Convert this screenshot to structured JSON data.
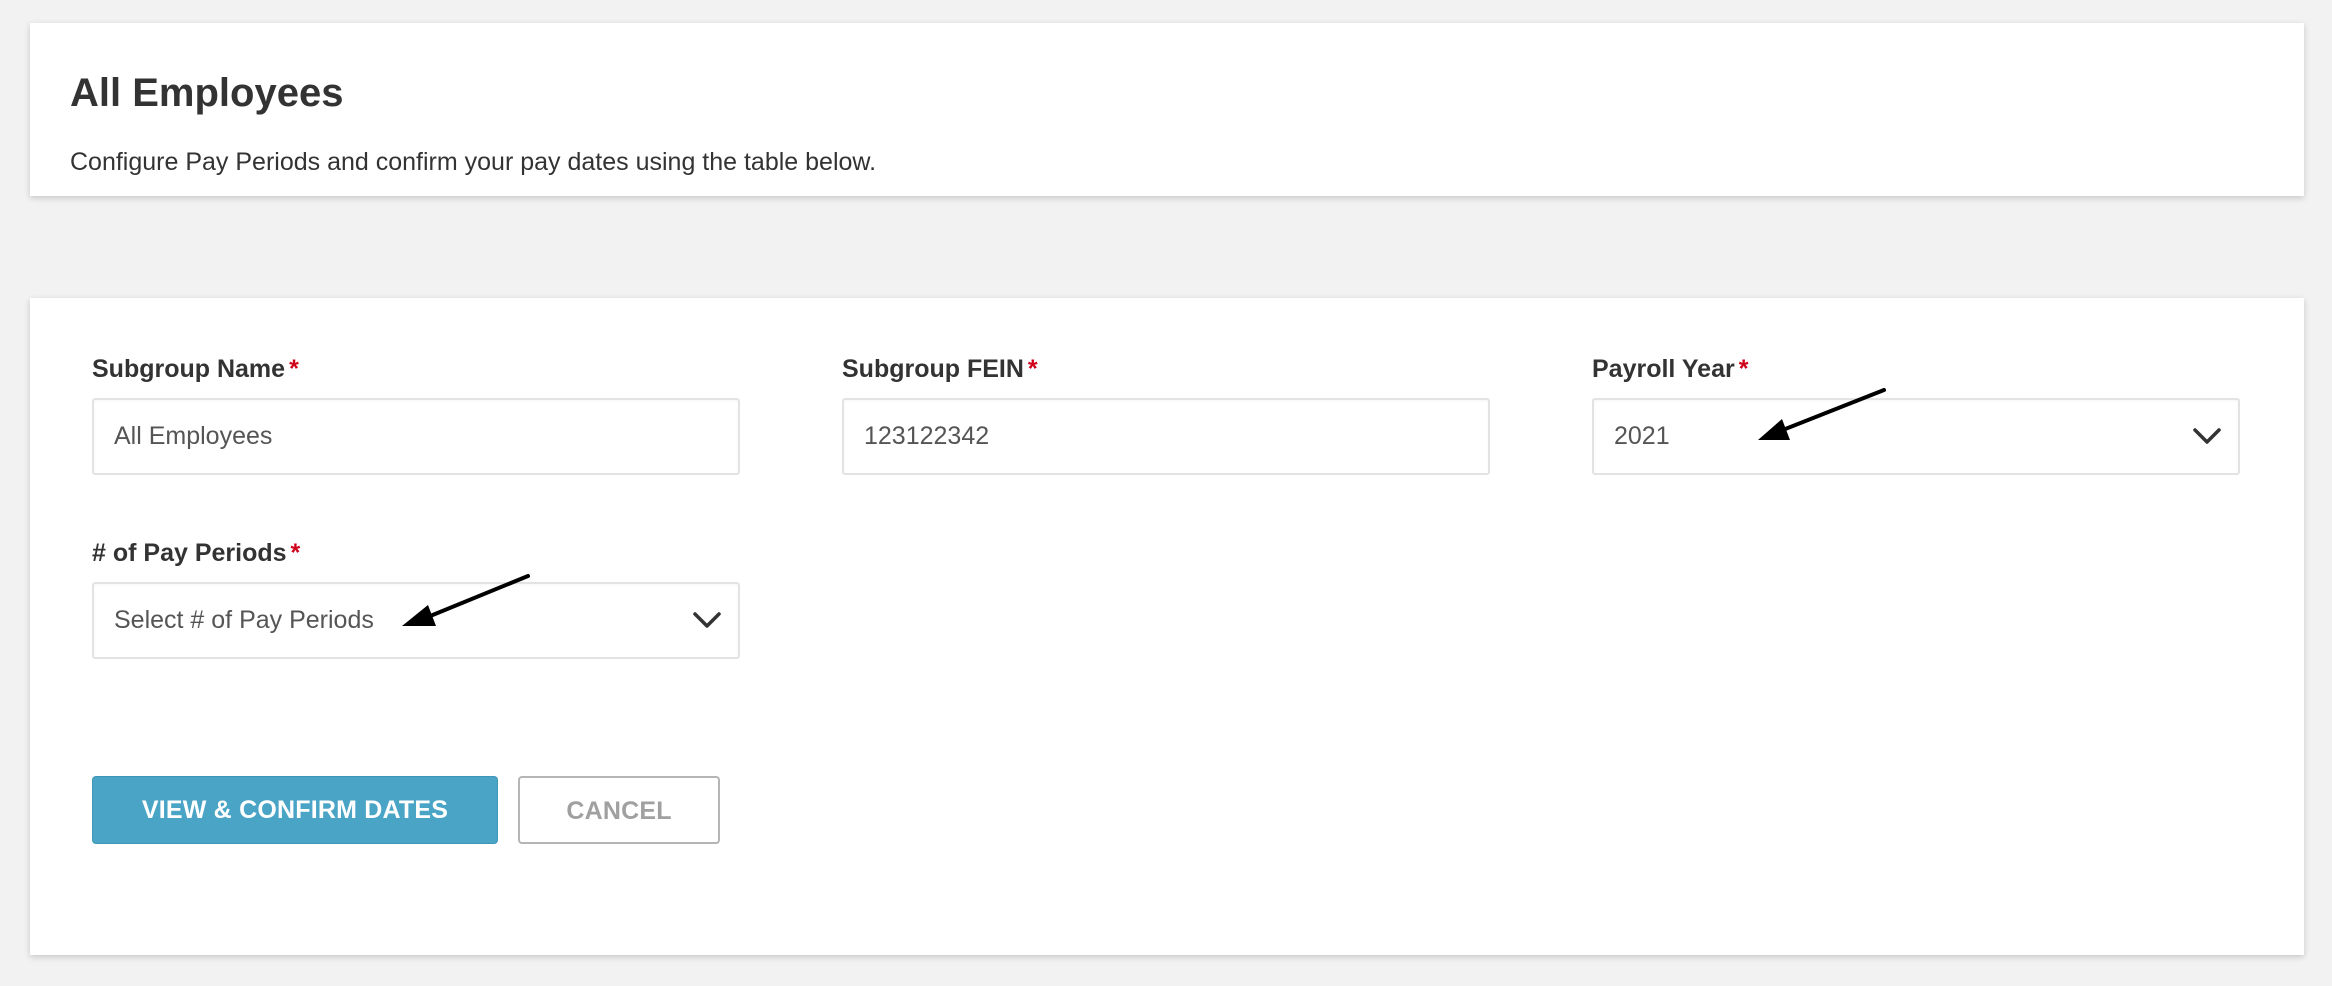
{
  "header": {
    "title": "All Employees",
    "subtitle": "Configure Pay Periods and confirm your pay dates using the table below."
  },
  "form": {
    "subgroup_name": {
      "label": "Subgroup Name",
      "required_mark": "*",
      "value": "All Employees"
    },
    "subgroup_fein": {
      "label": "Subgroup FEIN",
      "required_mark": "*",
      "value": "123122342"
    },
    "payroll_year": {
      "label": "Payroll Year",
      "required_mark": "*",
      "selected": "2021"
    },
    "pay_periods": {
      "label": "# of Pay Periods",
      "required_mark": "*",
      "placeholder": "Select # of Pay Periods"
    }
  },
  "buttons": {
    "primary_label": "VIEW & CONFIRM DATES",
    "secondary_label": "CANCEL"
  },
  "colors": {
    "page_background": "#f2f2f2",
    "primary_button": "#49a4c6",
    "required_star": "#d0021b",
    "annotation_arrow": "#000000"
  },
  "icons": {
    "select_chevron": "chevron-down-icon",
    "annotation": "arrow-pointer-icon"
  }
}
